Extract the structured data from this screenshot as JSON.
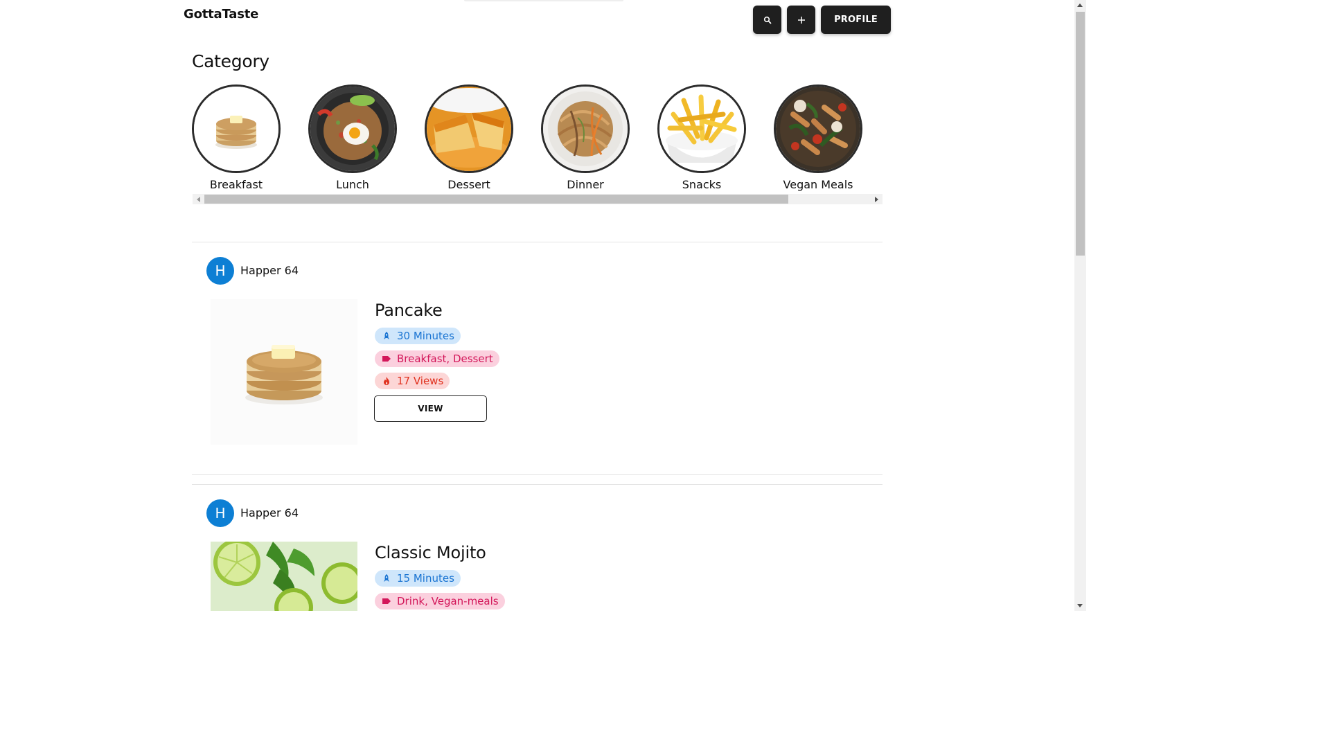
{
  "header": {
    "logo": "GottaTaste",
    "search_icon": "search-icon",
    "add_icon": "plus-icon",
    "profile_label": "PROFILE"
  },
  "category": {
    "title": "Category",
    "items": [
      {
        "label": "Breakfast",
        "image": "pancake-stack"
      },
      {
        "label": "Lunch",
        "image": "fried-rice-egg"
      },
      {
        "label": "Dessert",
        "image": "flan"
      },
      {
        "label": "Dinner",
        "image": "noodles"
      },
      {
        "label": "Snacks",
        "image": "french-fries"
      },
      {
        "label": "Vegan Meals",
        "image": "pasta-vegetables"
      }
    ]
  },
  "posts": [
    {
      "author_initial": "H",
      "author": "Happer 64",
      "title": "Pancake",
      "time": "30 Minutes",
      "tags": "Breakfast, Dessert",
      "views": "17 Views",
      "view_label": "VIEW"
    },
    {
      "author_initial": "H",
      "author": "Happer 64",
      "title": "Classic Mojito",
      "time": "15 Minutes",
      "tags": "Drink, Vegan-meals"
    }
  ],
  "colors": {
    "accent_blue": "#0d7fd4",
    "chip_time": "#1a74d2",
    "chip_tag": "#d3175a",
    "chip_views": "#e0321f"
  }
}
